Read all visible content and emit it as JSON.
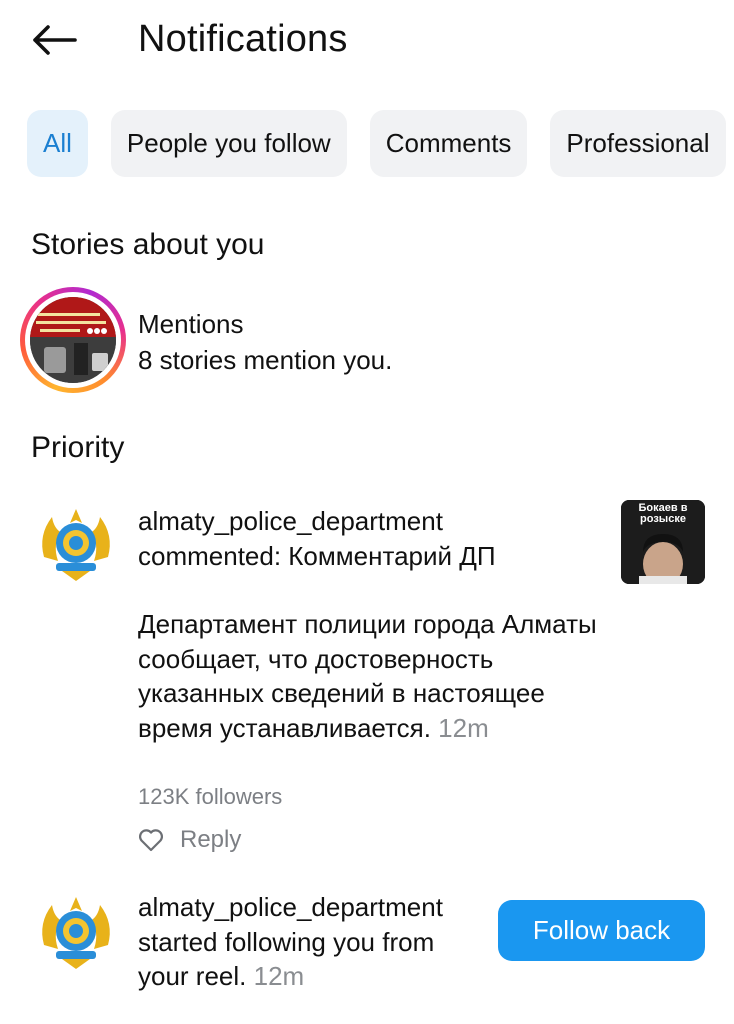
{
  "header": {
    "title": "Notifications"
  },
  "filters": [
    {
      "label": "All",
      "active": true
    },
    {
      "label": "People you follow"
    },
    {
      "label": "Comments"
    },
    {
      "label": "Professional"
    }
  ],
  "stories_section": {
    "title": "Stories about you",
    "mentions": {
      "title": "Mentions",
      "subtitle": "8 stories mention you."
    }
  },
  "priority_section": {
    "title": "Priority"
  },
  "notifications": [
    {
      "username": "almaty_police_department",
      "action": "commented: Комментарий ДП",
      "comment_body": "Департамент полиции города Алматы сообщает, что достоверность указанных сведений в настоящее время устанавливается.",
      "time": "12m",
      "followers": "123K followers",
      "reply_label": "Reply",
      "thumbnail_text": "Бокаев в розыске"
    },
    {
      "username": "almaty_police_department",
      "action": "started following you from your reel.",
      "time": "12m",
      "button_label": "Follow back"
    }
  ],
  "colors": {
    "accent": "#1a97f0",
    "chip_active_bg": "#e4f1fb",
    "chip_active_text": "#1a7fd1",
    "chip_bg": "#f1f2f4",
    "secondary_text": "#8a8d91"
  }
}
